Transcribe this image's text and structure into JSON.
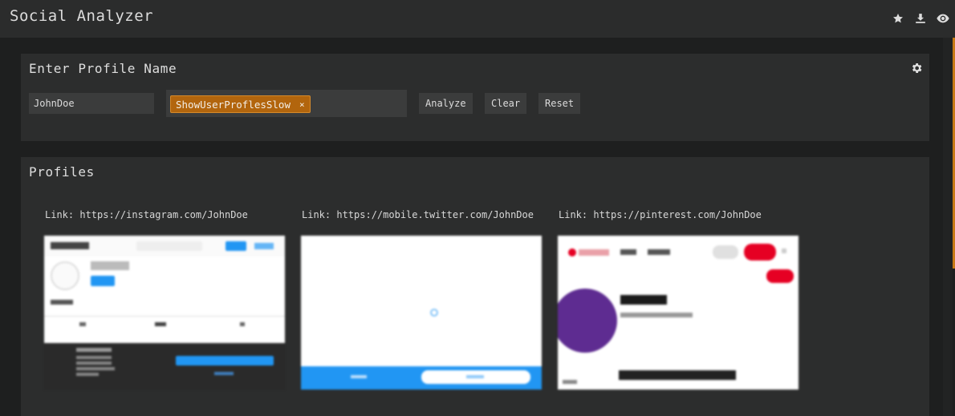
{
  "app": {
    "title": "Social Analyzer"
  },
  "toolbar_icons": [
    "star-icon",
    "download-icon",
    "eye-icon"
  ],
  "input_panel": {
    "title": "Enter Profile Name",
    "username_value": "JohnDoe",
    "options": [
      {
        "label": "ShowUserProflesSlow",
        "remove": "×"
      }
    ],
    "buttons": {
      "analyze": "Analyze",
      "clear": "Clear",
      "reset": "Reset"
    }
  },
  "profiles_panel": {
    "title": "Profiles",
    "items": [
      {
        "link": "Link: https://instagram.com/JohnDoe"
      },
      {
        "link": "Link: https://mobile.twitter.com/JohnDoe"
      },
      {
        "link": "Link: https://pinterest.com/JohnDoe"
      }
    ]
  },
  "colors": {
    "accent": "#b2650d",
    "background": "#1e1f1f",
    "panel": "#2c2d2d"
  }
}
